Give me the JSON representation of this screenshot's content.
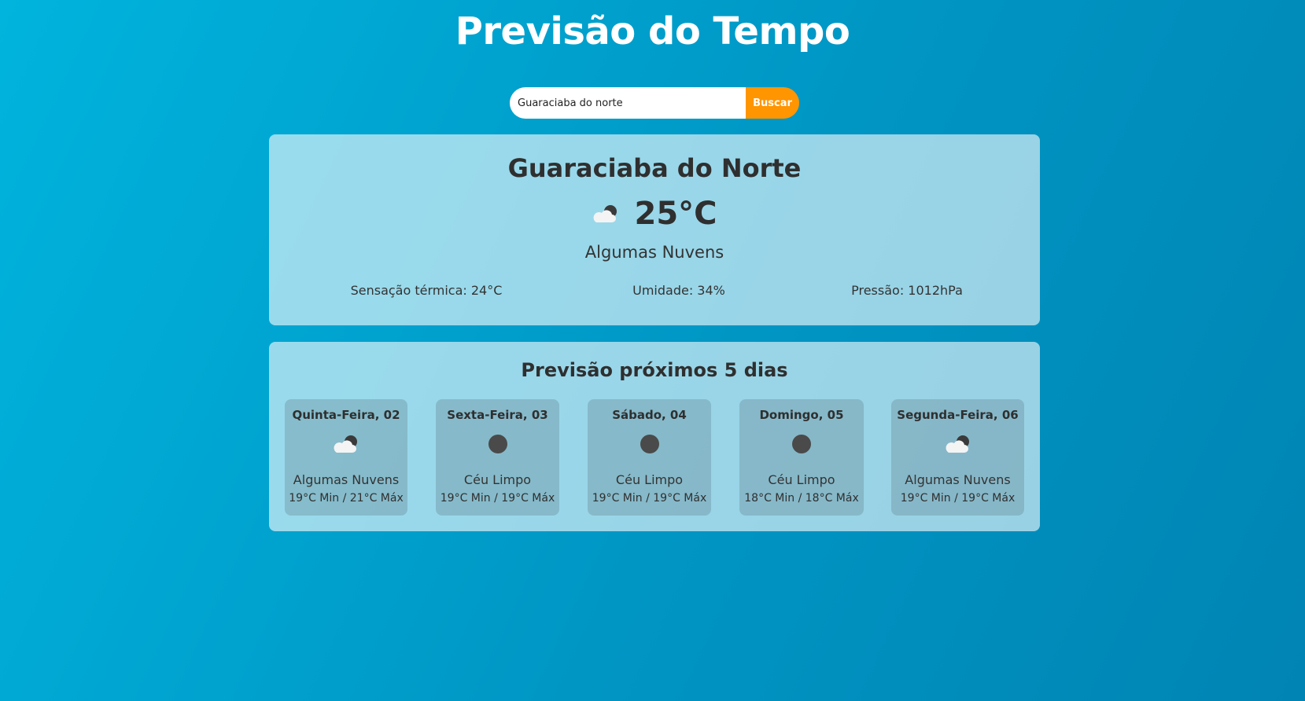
{
  "header": {
    "title": "Previsão do Tempo"
  },
  "search": {
    "value": "Guaraciaba do norte",
    "button_label": "Buscar"
  },
  "colors": {
    "accent": "#ff9500",
    "background_start": "#00b4dd",
    "background_end": "#0084b3"
  },
  "current": {
    "city": "Guaraciaba do Norte",
    "icon": "few-clouds-icon",
    "temperature": "25°C",
    "description": "Algumas Nuvens",
    "feels_like": "Sensação térmica: 24°C",
    "humidity": "Umidade: 34%",
    "pressure": "Pressão: 1012hPa"
  },
  "forecast": {
    "title": "Previsão próximos 5 dias",
    "days": [
      {
        "name": "Quinta-Feira, 02",
        "icon": "few-clouds-icon",
        "description": "Algumas Nuvens",
        "temps": "19°C Min / 21°C Máx"
      },
      {
        "name": "Sexta-Feira, 03",
        "icon": "clear-sky-icon",
        "description": "Céu Limpo",
        "temps": "19°C Min / 19°C Máx"
      },
      {
        "name": "Sábado, 04",
        "icon": "clear-sky-icon",
        "description": "Céu Limpo",
        "temps": "19°C Min / 19°C Máx"
      },
      {
        "name": "Domingo, 05",
        "icon": "clear-sky-icon",
        "description": "Céu Limpo",
        "temps": "18°C Min / 18°C Máx"
      },
      {
        "name": "Segunda-Feira, 06",
        "icon": "few-clouds-icon",
        "description": "Algumas Nuvens",
        "temps": "19°C Min / 19°C Máx"
      }
    ]
  }
}
